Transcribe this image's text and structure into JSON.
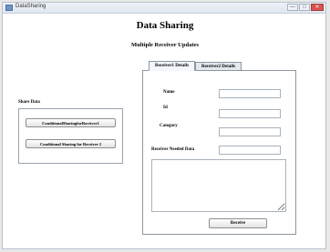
{
  "window": {
    "title": "DataSharing",
    "controls": {
      "minimize": "—",
      "maximize": "□",
      "close": "✕"
    }
  },
  "header": {
    "title": "Data Sharing",
    "subtitle": "Multiple Receiver Updates"
  },
  "share_panel": {
    "label": "Share Data",
    "buttons": [
      "ConditionalSharingforReceiver1",
      "Conditional Sharing for Receiver 2"
    ]
  },
  "tabs": [
    {
      "label": "Receiver1 Details",
      "selected": true
    },
    {
      "label": "Receiver2 Details",
      "selected": false
    }
  ],
  "form": {
    "name_label": "Name",
    "id_label": "Id",
    "category_label": "Category",
    "needed_data_label": "Receiver Needed Data",
    "name_value": "",
    "id_value": "",
    "category_value": "",
    "needed_data_value": "",
    "details_value": "",
    "receive_label": "Receive"
  }
}
